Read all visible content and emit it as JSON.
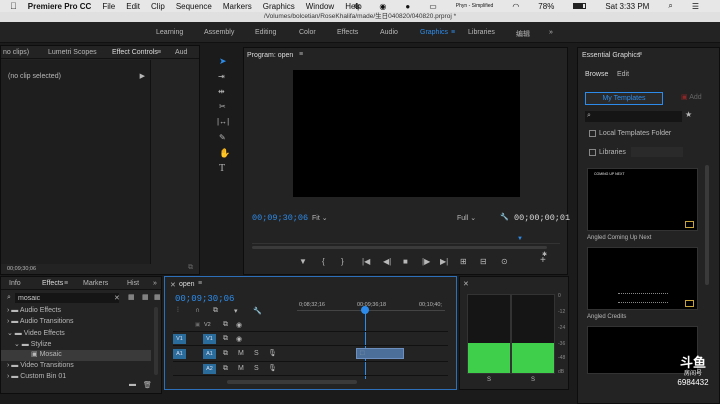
{
  "menubar": {
    "apple": "",
    "app": "Premiere Pro CC",
    "items": [
      "File",
      "Edit",
      "Clip",
      "Sequence",
      "Markers",
      "Graphics",
      "Window",
      "Help"
    ],
    "battery": "78%",
    "clock": "Sat 3:33 PM",
    "phyn": "Phyn - Simplified"
  },
  "title": "/Volumes/bolcetian/RoseKhalifa/made/生日040820/040820.prproj *",
  "workspaces": [
    "Learning",
    "Assembly",
    "Editing",
    "Color",
    "Effects",
    "Audio",
    "Graphics",
    "Libraries",
    "编辑"
  ],
  "source_tabs": [
    "no clips)",
    "Lumetri Scopes",
    "Effect Controls",
    "Aud"
  ],
  "effect_controls": {
    "no_clip": "(no clip selected)",
    "timecode": "00;09;30;06"
  },
  "program": {
    "title": "Program: open",
    "timecode": "00;09;30;06",
    "fit": "Fit",
    "quality": "Full",
    "duration": "00;00;00;01"
  },
  "effects_tabs": [
    "Info",
    "Effects",
    "Markers",
    "Hist"
  ],
  "effects_search": "mosaic",
  "effects_tree": [
    "Audio Effects",
    "Audio Transitions",
    "Video Effects",
    "Stylize",
    "Mosaic",
    "Video Transitions",
    "Custom Bin 01"
  ],
  "timeline": {
    "tab": "open",
    "timecode": "00;09;30;06",
    "ruler": [
      "0;08;32;16",
      "00;09;36;18",
      "00;10;40;"
    ],
    "tracks": [
      "V2",
      "V1",
      "A1",
      "A2"
    ],
    "sources": [
      "V1",
      "A1"
    ],
    "m": "M",
    "s": "S"
  },
  "meter": {
    "scale": [
      "0",
      "-12",
      "-24",
      "-36",
      "-48",
      "dB"
    ],
    "s_labels": [
      "S",
      "S"
    ]
  },
  "essential": {
    "title": "Essential Graphics",
    "tabs": [
      "Browse",
      "Edit"
    ],
    "my_templates": "My Templates",
    "add": "Add",
    "local": "Local Templates Folder",
    "libraries": "Libraries",
    "t1_text": "COMING UP NEXT",
    "t1": "Angled Coming Up Next",
    "t2": "Angled Credits"
  },
  "watermark": {
    "brand": "斗鱼",
    "sub": "房间号",
    "id": "6984432"
  }
}
